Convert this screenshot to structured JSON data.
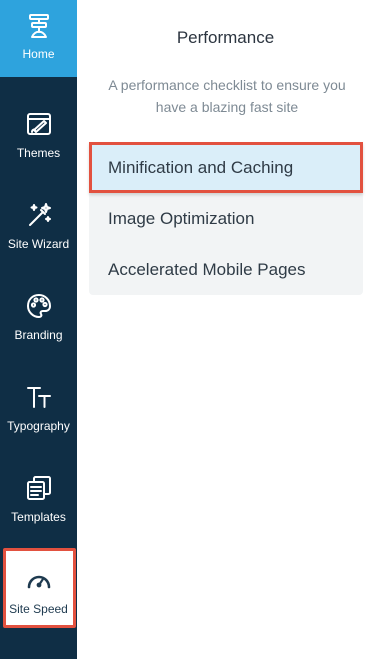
{
  "sidebar": {
    "items": [
      {
        "label": "Home",
        "icon": "home-icon"
      },
      {
        "label": "Themes",
        "icon": "themes-icon"
      },
      {
        "label": "Site Wizard",
        "icon": "magic-wand-icon"
      },
      {
        "label": "Branding",
        "icon": "palette-icon"
      },
      {
        "label": "Typography",
        "icon": "typography-icon"
      },
      {
        "label": "Templates",
        "icon": "templates-icon"
      },
      {
        "label": "Site Speed",
        "icon": "speedometer-icon"
      }
    ],
    "active_label": "Home",
    "highlighted_label": "Site Speed"
  },
  "panel": {
    "title": "Performance",
    "description": "A performance checklist to ensure you have a blazing fast site",
    "items": [
      {
        "label": "Minification and Caching"
      },
      {
        "label": "Image Optimization"
      },
      {
        "label": "Accelerated Mobile Pages"
      }
    ],
    "selected_label": "Minification and Caching"
  },
  "colors": {
    "sidebar_bg": "#0f2e45",
    "active_nav_bg": "#2ea3dd",
    "highlight_border": "#e2513f",
    "selected_item_bg": "#daeef9",
    "list_bg": "#f2f4f5"
  }
}
